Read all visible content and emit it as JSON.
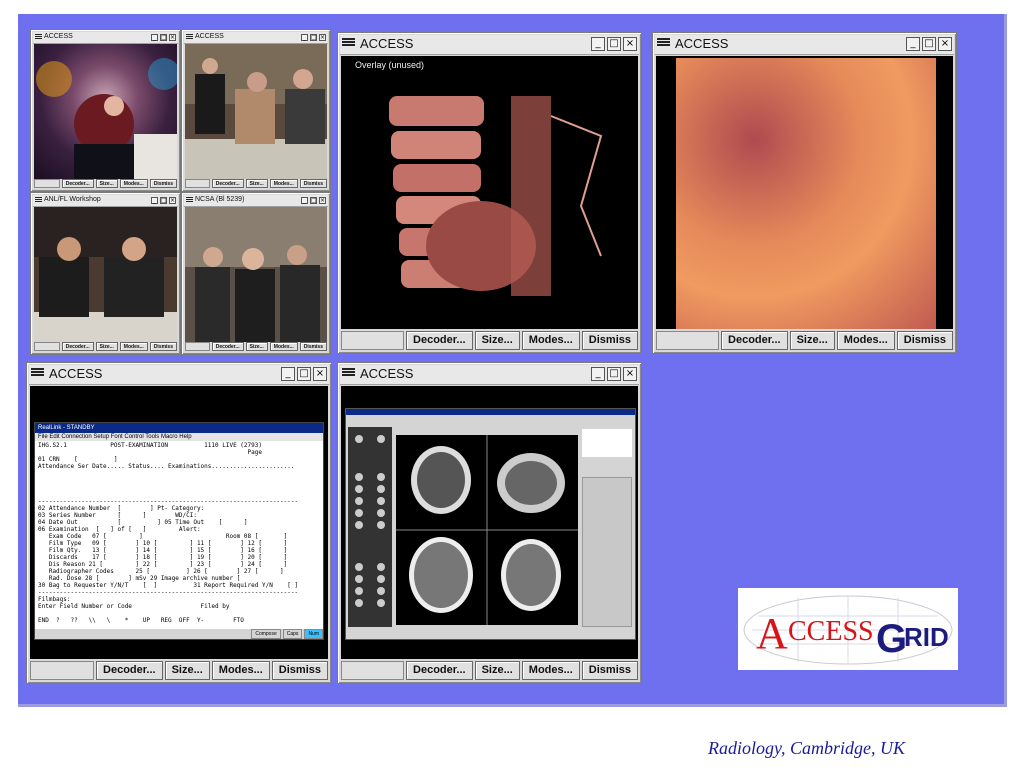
{
  "windows": {
    "w1": {
      "title": "ACCESS",
      "buttons": [
        "Decoder...",
        "Size...",
        "Modes...",
        "Dismiss"
      ]
    },
    "w2": {
      "title": "ACCESS",
      "buttons": [
        "Decoder...",
        "Size...",
        "Modes...",
        "Dismiss"
      ]
    },
    "w3": {
      "title": "ANL/FL Workshop",
      "buttons": [
        "Decoder...",
        "Size...",
        "Modes...",
        "Dismiss"
      ]
    },
    "w4": {
      "title": "NCSA (Bl 5239)",
      "buttons": [
        "Decoder...",
        "Size...",
        "Modes...",
        "Dismiss"
      ]
    },
    "w5": {
      "title": "ACCESS",
      "overlay": "Overlay (unused)",
      "buttons": [
        "Decoder...",
        "Size...",
        "Modes...",
        "Dismiss"
      ]
    },
    "w6": {
      "title": "ACCESS",
      "buttons": [
        "Decoder...",
        "Size...",
        "Modes...",
        "Dismiss"
      ]
    },
    "w7": {
      "title": "ACCESS",
      "buttons": [
        "Decoder...",
        "Size...",
        "Modes...",
        "Dismiss"
      ]
    },
    "w8": {
      "title": "ACCESS",
      "buttons": [
        "Decoder...",
        "Size...",
        "Modes...",
        "Dismiss"
      ]
    }
  },
  "terminal": {
    "title": "RealLink - STANDBY",
    "menu": "File  Edit  Connection  Setup  Font  Control  Tools  Macro  Help",
    "lines": [
      "IHG.S2.1            POST-EXAMINATION          1110 LIVE (2793)",
      "                                                          Page",
      "01 CRN    [          ]",
      "Attendance Ser Date..... Status.... Examinations.......................",
      "",
      "",
      "",
      "",
      "------------------------------------------------------------------------",
      "02 Attendance Number  [        ] Pt- Category:",
      "03 Series Number      [      ]        WD/CI:",
      "04 Date Out           [          ] 05 Time Out    [      ]",
      "06 Examination  [   ] of [   ]         Alert:",
      "   Exam Code   07 [         ]                       Room 08 [       ]",
      "   Film Type   09 [        ] 10 [         ] 11 [        ] 12 [      ]",
      "   Film Qty.   13 [        ] 14 [         ] 15 [        ] 16 [      ]",
      "   Discards    17 [        ] 18 [         ] 19 [        ] 20 [      ]",
      "   Dis Reason 21 [         ] 22 [         ] 23 [        ] 24 [      ]",
      "   Radiographer Codes      25 [          ] 26 [        ] 27 [      ]",
      "   Rad. Dose 28 [        ] mSv 29 Image archive number [",
      "30 Bag to Requester Y/N/T    [  ]          31 Report Required Y/N    [ ]",
      "------------------------------------------------------------------------",
      "Filmbags:",
      "Enter Field Number or Code                   Filed by",
      "",
      "END  ?   ??   \\\\   \\    *    UP   REG  OFF  Y-        FTO"
    ],
    "status": [
      "Compose",
      "Caps",
      "Num"
    ]
  },
  "caption": "Radiology,  Cambridge,  UK",
  "logo_text": "ACCESSGRID",
  "logo_letters": {
    "a": "A",
    "ccess": "CCESS",
    "g": "G",
    "rid": "RID"
  },
  "colors": {
    "desktop": "#6e70f0",
    "logo_red": "#d8141a",
    "logo_blue": "#1c1c7c",
    "caption": "#1a1a9a"
  }
}
